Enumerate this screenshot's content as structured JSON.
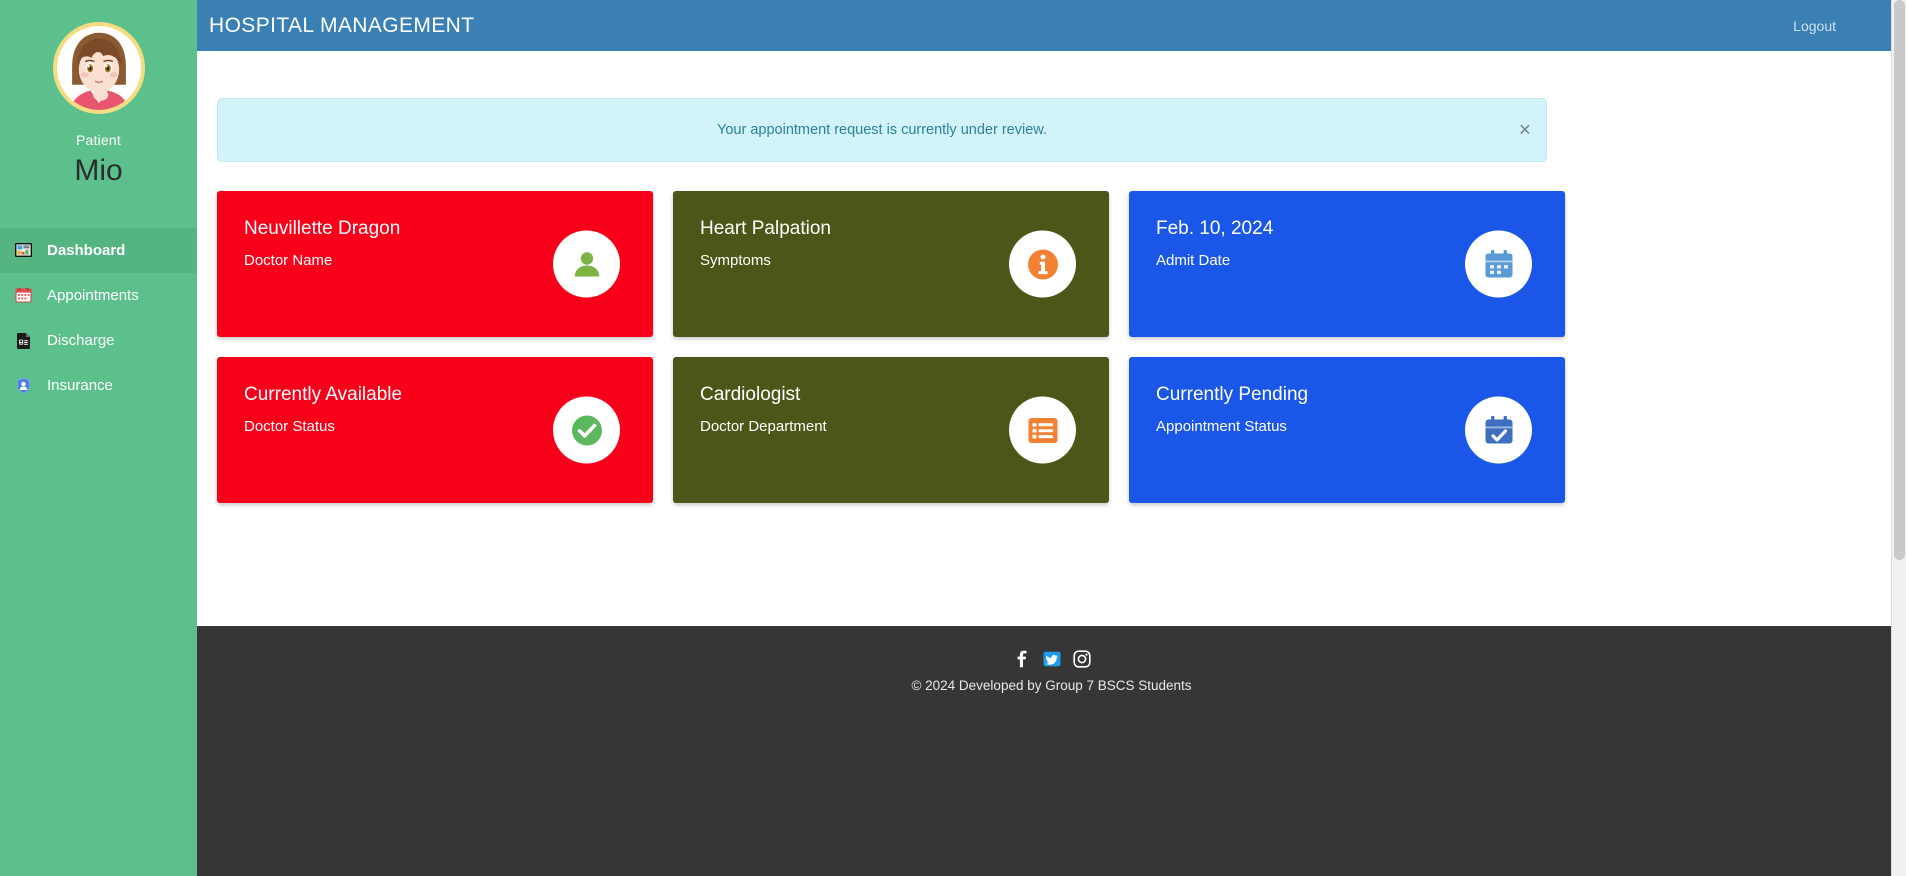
{
  "sidebar": {
    "profile": {
      "avatar_icon": "patient-avatar",
      "role": "Patient",
      "name": "Mio"
    },
    "items": [
      {
        "label": "Dashboard",
        "icon": "dashboard-icon",
        "active": true
      },
      {
        "label": "Appointments",
        "icon": "calendar-icon",
        "active": false
      },
      {
        "label": "Discharge",
        "icon": "document-icon",
        "active": false
      },
      {
        "label": "Insurance",
        "icon": "shield-user-icon",
        "active": false
      }
    ],
    "bg_color": "#5cc08d",
    "active_bg_color": "#54b583"
  },
  "header": {
    "title": "HOSPITAL MANAGEMENT",
    "logout_label": "Logout",
    "bg_color": "#3a80b5"
  },
  "alert": {
    "message": "Your appointment request is currently under review.",
    "close_label": "×",
    "bg_color": "#d3f3fa",
    "text_color": "#28839a"
  },
  "cards": [
    {
      "value": "Neuvillette Dragon",
      "label": "Doctor Name",
      "icon": "person-icon",
      "bg_color": "#f80019",
      "icon_color": "#7cb342"
    },
    {
      "value": "Heart Palpation",
      "label": "Symptoms",
      "icon": "info-icon",
      "bg_color": "#4d5618",
      "icon_color": "#f28133"
    },
    {
      "value": "Feb. 10, 2024",
      "label": "Admit Date",
      "icon": "calendar-icon",
      "bg_color": "#1a56e8",
      "icon_color": "#5b9bd5"
    },
    {
      "value": "Currently Available",
      "label": "Doctor Status",
      "icon": "check-circle-icon",
      "bg_color": "#f80019",
      "icon_color": "#5cb85c"
    },
    {
      "value": "Cardiologist",
      "label": "Doctor Department",
      "icon": "list-icon",
      "bg_color": "#4d5618",
      "icon_color": "#f28133"
    },
    {
      "value": "Currently Pending",
      "label": "Appointment Status",
      "icon": "calendar-check-icon",
      "bg_color": "#1a56e8",
      "icon_color": "#3f6fbf"
    }
  ],
  "footer": {
    "socials": [
      {
        "name": "facebook-icon",
        "glyph": "f",
        "color": "#ffffff"
      },
      {
        "name": "twitter-icon",
        "glyph": "t",
        "color": "#1d9bf0"
      },
      {
        "name": "instagram-icon",
        "glyph": "ig",
        "color": "#ffffff"
      }
    ],
    "copyright": "© 2024 Developed by Group 7 BSCS Students",
    "bg_color": "#363636"
  }
}
